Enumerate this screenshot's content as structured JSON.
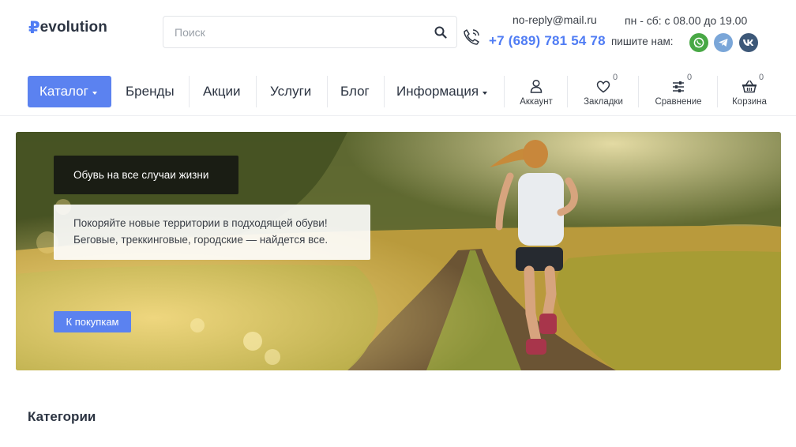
{
  "brand": {
    "logo_mark": "₽",
    "logo_text": "evolution",
    "accent": "#4f7cf4"
  },
  "search": {
    "placeholder": "Поиск",
    "icon": "search-icon"
  },
  "contacts": {
    "email": "no-reply@mail.ru",
    "phone": "+7 (689) 781 54 78",
    "hours": "пн - сб: с 08.00 до 19.00",
    "write_us": "пишите нам:",
    "socials": [
      {
        "name": "whatsapp",
        "color": "#48a845"
      },
      {
        "name": "telegram",
        "color": "#7aa6d8"
      },
      {
        "name": "vk",
        "color": "#3d5878"
      }
    ]
  },
  "nav": {
    "catalog": "Каталог",
    "items": [
      {
        "label": "Бренды"
      },
      {
        "label": "Акции"
      },
      {
        "label": "Услуги"
      },
      {
        "label": "Блог"
      },
      {
        "label": "Информация"
      }
    ],
    "utilities": [
      {
        "label": "Аккаунт",
        "icon": "user-icon",
        "count": ""
      },
      {
        "label": "Закладки",
        "icon": "heart-icon",
        "count": "0"
      },
      {
        "label": "Сравнение",
        "icon": "sliders-icon",
        "count": "0"
      },
      {
        "label": "Корзина",
        "icon": "basket-icon",
        "count": "0"
      }
    ]
  },
  "hero": {
    "title": "Обувь на все случаи жизни",
    "description_line1": "Покоряйте новые территории в подходящей обуви!",
    "description_line2": "Беговые, треккинговые, городские — найдется все.",
    "button": "К покупкам"
  },
  "categories": {
    "title": "Категории"
  }
}
